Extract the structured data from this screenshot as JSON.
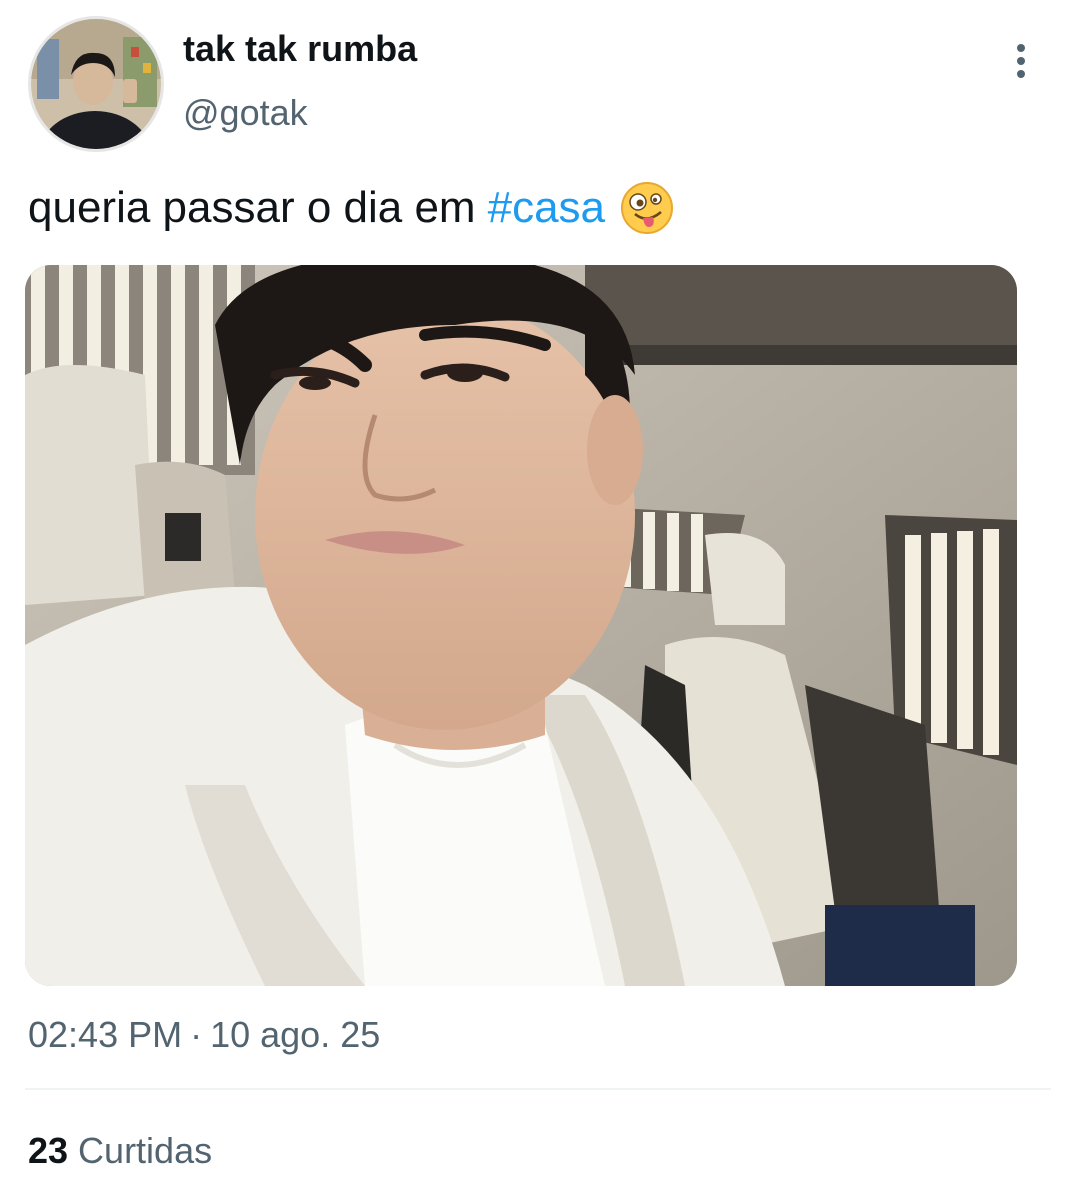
{
  "author": {
    "display_name": "tak tak rumba",
    "handle": "@gotak"
  },
  "tweet": {
    "text": "queria passar o dia em",
    "hashtag": "#casa",
    "emoji": "zany-face-emoji"
  },
  "meta": {
    "time": "02:43 PM",
    "separator": "·",
    "date": "10 ago. 25"
  },
  "engagement": {
    "likes_count": "23",
    "likes_label": "Curtidas"
  },
  "icons": {
    "more": "vertical-ellipsis-icon"
  },
  "colors": {
    "link": "#1d9bf0",
    "secondary_text": "#536471",
    "primary_text": "#0f1419"
  }
}
